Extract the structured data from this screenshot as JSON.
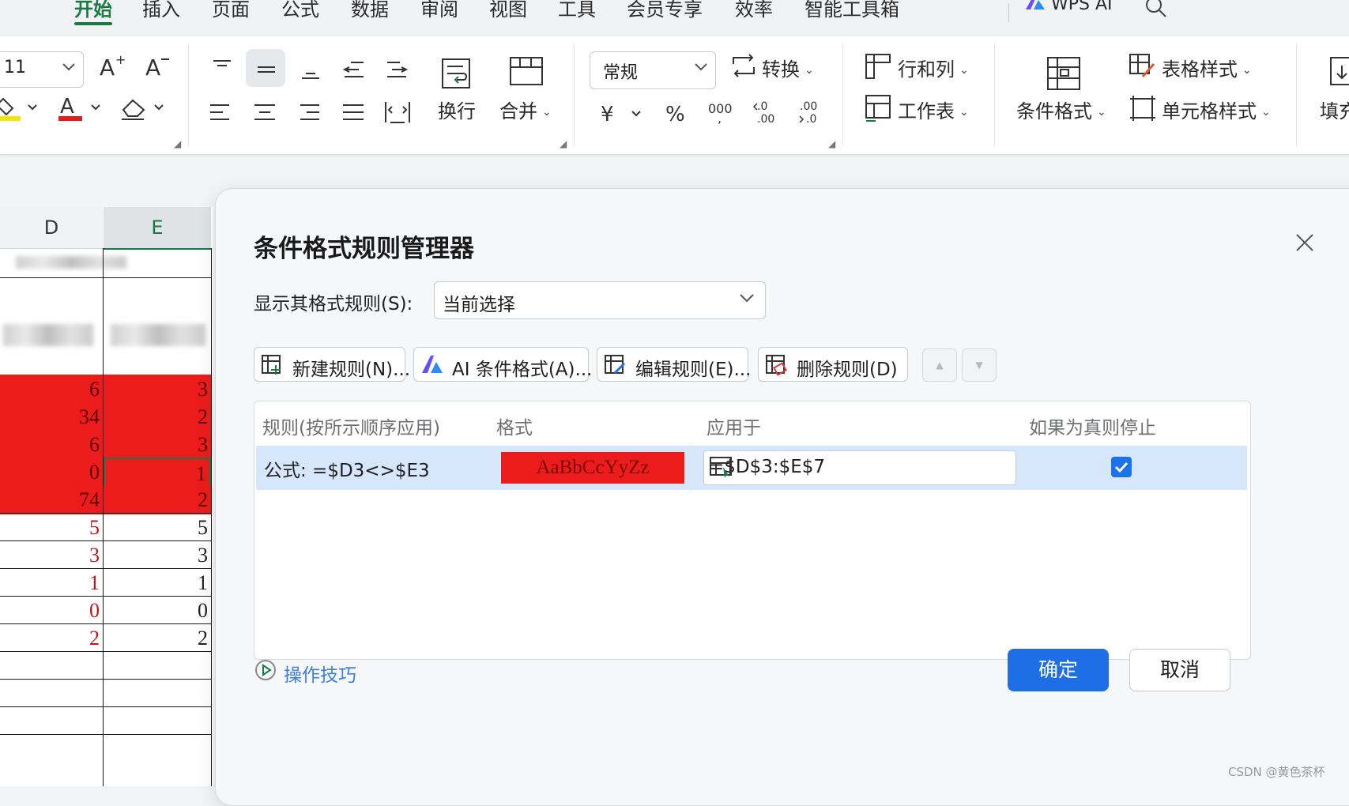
{
  "menu": {
    "tabs": [
      "开始",
      "插入",
      "页面",
      "公式",
      "数据",
      "审阅",
      "视图",
      "工具",
      "会员专享",
      "效率",
      "智能工具箱"
    ],
    "active_index": 0,
    "wps_ai": "WPS AI"
  },
  "ribbon": {
    "font_size": "11",
    "wrap_label": "换行",
    "merge_label": "合并",
    "number_format": "常规",
    "convert_label": "转换",
    "rows_cols_label": "行和列",
    "worksheet_label": "工作表",
    "cond_format_label": "条件格式",
    "table_style_label": "表格样式",
    "cell_style_label": "单元格样式",
    "fill_label": "填充"
  },
  "sheet": {
    "columns": [
      "D",
      "E"
    ],
    "selected_column": "E",
    "rows": [
      {
        "d": "6",
        "e": "3",
        "highlight": true
      },
      {
        "d": "34",
        "e": "2",
        "highlight": true
      },
      {
        "d": "6",
        "e": "3",
        "highlight": true
      },
      {
        "d": "0",
        "e": "1",
        "highlight": true
      },
      {
        "d": "74",
        "e": "2",
        "highlight": true
      },
      {
        "d": "5",
        "e": "5",
        "highlight": false
      },
      {
        "d": "3",
        "e": "3",
        "highlight": false
      },
      {
        "d": "1",
        "e": "1",
        "highlight": false
      },
      {
        "d": "0",
        "e": "0",
        "highlight": false
      },
      {
        "d": "2",
        "e": "2",
        "highlight": false
      }
    ]
  },
  "dialog": {
    "title": "条件格式规则管理器",
    "show_rules_label": "显示其格式规则(S):",
    "show_rules_value": "当前选择",
    "buttons": {
      "new_rule": "新建规则(N)...",
      "ai_format": "AI 条件格式(A)...",
      "edit_rule": "编辑规则(E)...",
      "delete_rule": "删除规则(D)"
    },
    "grid_headers": {
      "rule": "规则(按所示顺序应用)",
      "format": "格式",
      "applies_to": "应用于",
      "stop_if_true": "如果为真则停止"
    },
    "rule_row": {
      "rule": "公式: =$D3<>$E3",
      "format_preview": "AaBbCcYyZz",
      "applies_to": "=$D$3:$E$7",
      "stop_if_true": true
    },
    "tips": "操作技巧",
    "ok": "确定",
    "cancel": "取消"
  },
  "watermark": "CSDN @黄色茶杯",
  "colors": {
    "accent_green": "#1b7a43",
    "highlight_red": "#ed1c1c",
    "primary_blue": "#1e6fe6",
    "selected_row": "#d6e6fb"
  }
}
